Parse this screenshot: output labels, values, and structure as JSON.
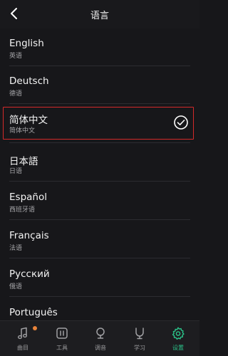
{
  "header": {
    "title": "语言",
    "back_icon": "back-arrow-icon"
  },
  "languages": [
    {
      "name": "English",
      "sub": "英语",
      "selected": false
    },
    {
      "name": "Deutsch",
      "sub": "德语",
      "selected": false
    },
    {
      "name": "简体中文",
      "sub": "简体中文",
      "selected": true
    },
    {
      "name": "日本語",
      "sub": "日语",
      "selected": false
    },
    {
      "name": "Español",
      "sub": "西班牙语",
      "selected": false
    },
    {
      "name": "Français",
      "sub": "法语",
      "selected": false
    },
    {
      "name": "Русский",
      "sub": "俄语",
      "selected": false
    },
    {
      "name": "Português",
      "sub": "",
      "selected": false
    }
  ],
  "tabs": [
    {
      "label": "曲目",
      "icon": "music-note-icon",
      "active": false,
      "badge": true
    },
    {
      "label": "工具",
      "icon": "tools-icon",
      "active": false,
      "badge": false
    },
    {
      "label": "调音",
      "icon": "tuner-icon",
      "active": false,
      "badge": false
    },
    {
      "label": "学习",
      "icon": "learn-icon",
      "active": false,
      "badge": false
    },
    {
      "label": "设置",
      "icon": "gear-icon",
      "active": true,
      "badge": false
    }
  ],
  "colors": {
    "accent": "#2bc48a",
    "highlight_border": "#d42a2a",
    "badge": "#e8833a"
  }
}
